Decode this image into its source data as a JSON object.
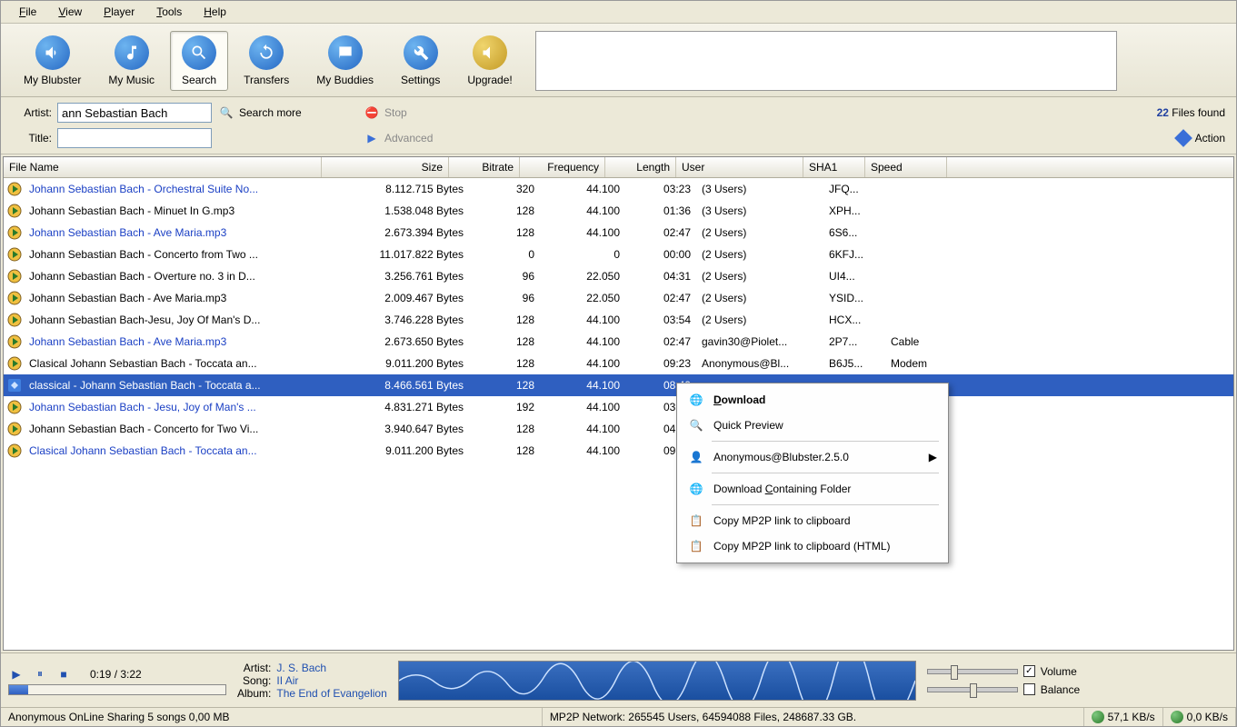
{
  "menubar": [
    "File",
    "View",
    "Player",
    "Tools",
    "Help"
  ],
  "toolbar": [
    {
      "label": "My Blubster",
      "icon": "speaker",
      "color": "blue"
    },
    {
      "label": "My Music",
      "icon": "music",
      "color": "blue"
    },
    {
      "label": "Search",
      "icon": "search",
      "color": "blue",
      "active": true
    },
    {
      "label": "Transfers",
      "icon": "refresh",
      "color": "blue"
    },
    {
      "label": "My Buddies",
      "icon": "buddies",
      "color": "blue"
    },
    {
      "label": "Settings",
      "icon": "wrench",
      "color": "blue"
    },
    {
      "label": "Upgrade!",
      "icon": "upgrade",
      "color": "gold"
    }
  ],
  "search": {
    "artist_label": "Artist:",
    "artist_value": "ann Sebastian Bach",
    "title_label": "Title:",
    "title_value": "",
    "search_more": "Search more",
    "stop": "Stop",
    "advanced": "Advanced",
    "files_found_num": "22",
    "files_found_label": "Files found",
    "action": "Action"
  },
  "columns": [
    "File Name",
    "Size",
    "Bitrate",
    "Frequency",
    "Length",
    "User",
    "SHA1",
    "Speed"
  ],
  "rows": [
    {
      "file": "Johann Sebastian Bach - Orchestral Suite No...",
      "size": "8.112.715 Bytes",
      "bitrate": "320",
      "freq": "44.100",
      "len": "03:23",
      "user": "(3 Users)",
      "sha": "JFQ...",
      "speed": "",
      "link": true
    },
    {
      "file": "Johann Sebastian Bach - Minuet In G.mp3",
      "size": "1.538.048 Bytes",
      "bitrate": "128",
      "freq": "44.100",
      "len": "01:36",
      "user": "(3 Users)",
      "sha": "XPH...",
      "speed": "",
      "link": false
    },
    {
      "file": "Johann Sebastian Bach - Ave Maria.mp3",
      "size": "2.673.394 Bytes",
      "bitrate": "128",
      "freq": "44.100",
      "len": "02:47",
      "user": "(2 Users)",
      "sha": "6S6...",
      "speed": "",
      "link": true
    },
    {
      "file": "Johann Sebastian Bach - Concerto from Two ...",
      "size": "11.017.822 Bytes",
      "bitrate": "0",
      "freq": "0",
      "len": "00:00",
      "user": "(2 Users)",
      "sha": "6KFJ...",
      "speed": "",
      "link": false
    },
    {
      "file": "Johann Sebastian Bach - Overture no. 3 in D...",
      "size": "3.256.761 Bytes",
      "bitrate": "96",
      "freq": "22.050",
      "len": "04:31",
      "user": "(2 Users)",
      "sha": "UI4...",
      "speed": "",
      "link": false
    },
    {
      "file": "Johann Sebastian Bach - Ave Maria.mp3",
      "size": "2.009.467 Bytes",
      "bitrate": "96",
      "freq": "22.050",
      "len": "02:47",
      "user": "(2 Users)",
      "sha": "YSID...",
      "speed": "",
      "link": false
    },
    {
      "file": "Johann Sebastian Bach-Jesu, Joy Of Man's D...",
      "size": "3.746.228 Bytes",
      "bitrate": "128",
      "freq": "44.100",
      "len": "03:54",
      "user": "(2 Users)",
      "sha": "HCX...",
      "speed": "",
      "link": false
    },
    {
      "file": "Johann Sebastian Bach - Ave Maria.mp3",
      "size": "2.673.650 Bytes",
      "bitrate": "128",
      "freq": "44.100",
      "len": "02:47",
      "user": "gavin30@Piolet...",
      "sha": "2P7...",
      "speed": "Cable",
      "link": true
    },
    {
      "file": "Clasical Johann Sebastian Bach - Toccata an...",
      "size": "9.011.200 Bytes",
      "bitrate": "128",
      "freq": "44.100",
      "len": "09:23",
      "user": "Anonymous@Bl...",
      "sha": "B6J5...",
      "speed": "Modem",
      "link": false
    },
    {
      "file": "classical - Johann Sebastian Bach - Toccata a...",
      "size": "8.466.561 Bytes",
      "bitrate": "128",
      "freq": "44.100",
      "len": "08:49",
      "user": "",
      "sha": "",
      "speed": "",
      "link": false,
      "selected": true
    },
    {
      "file": "Johann Sebastian Bach - Jesu, Joy of Man's ...",
      "size": "4.831.271 Bytes",
      "bitrate": "192",
      "freq": "44.100",
      "len": "03:21",
      "user": "",
      "sha": "",
      "speed": "",
      "link": true
    },
    {
      "file": "Johann Sebastian Bach - Concerto for Two Vi...",
      "size": "3.940.647 Bytes",
      "bitrate": "128",
      "freq": "44.100",
      "len": "04:06",
      "user": "",
      "sha": "",
      "speed": "",
      "link": false
    },
    {
      "file": "Clasical Johann Sebastian Bach - Toccata an...",
      "size": "9.011.200 Bytes",
      "bitrate": "128",
      "freq": "44.100",
      "len": "09:23",
      "user": "",
      "sha": "",
      "speed": "",
      "link": true
    }
  ],
  "context_menu": [
    {
      "label": "Download",
      "bold": true,
      "icon": "globe"
    },
    {
      "label": "Quick Preview",
      "icon": "preview"
    },
    {
      "sep": true
    },
    {
      "label": "Anonymous@Blubster.2.5.0",
      "icon": "user",
      "submenu": true
    },
    {
      "sep": true
    },
    {
      "label": "Download Containing Folder",
      "icon": "globe"
    },
    {
      "sep": true
    },
    {
      "label": "Copy MP2P link to clipboard",
      "icon": "copy"
    },
    {
      "label": "Copy MP2P link to clipboard (HTML)",
      "icon": "copy"
    }
  ],
  "player": {
    "time": "0:19 / 3:22",
    "artist_label": "Artist:",
    "artist": "J. S. Bach",
    "song_label": "Song:",
    "song": "II Air",
    "album_label": "Album:",
    "album": "The End of Evangelion",
    "volume_label": "Volume",
    "balance_label": "Balance",
    "progress_pct": 9
  },
  "status": {
    "left": "Anonymous OnLine Sharing 5 songs 0,00 MB",
    "mid": "MP2P Network: 265545 Users, 64594088 Files, 248687.33 GB.",
    "down": "57,1 KB/s",
    "up": "0,0  KB/s"
  }
}
